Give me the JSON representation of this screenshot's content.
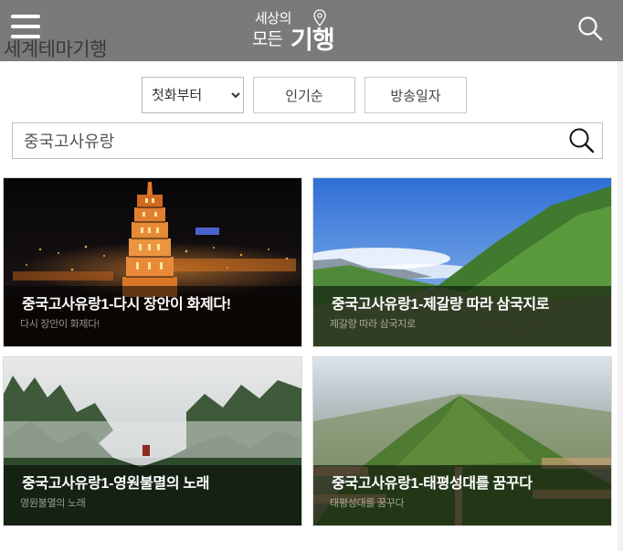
{
  "header": {
    "logo_line1": "세상의",
    "logo_line2": "모든",
    "logo_line3": "기행",
    "section_title": "세계테마기행"
  },
  "filters": {
    "sort_selected": "첫화부터",
    "popular_label": "인기순",
    "date_label": "방송일자"
  },
  "search": {
    "value": "중국고사유랑"
  },
  "cards": [
    {
      "title": "중국고사유랑1-다시 장안이 화제다!",
      "subtitle": "다시 장안이 화제다!"
    },
    {
      "title": "중국고사유랑1-제갈량 따라 삼국지로",
      "subtitle": "제갈량 따라 삼국지로"
    },
    {
      "title": "중국고사유랑1-영원불멸의 노래",
      "subtitle": "영원불멸의 노래"
    },
    {
      "title": "중국고사유랑1-태평성대를 꿈꾸다",
      "subtitle": "태평성대를 꿈꾸다"
    }
  ],
  "icons": {
    "menu": "hamburger-menu-icon",
    "search": "search-icon",
    "logo_pin": "location-pin-icon"
  },
  "colors": {
    "header_bg": "#7a7a7a",
    "overlay": "rgba(0,0,0,0.55)"
  }
}
